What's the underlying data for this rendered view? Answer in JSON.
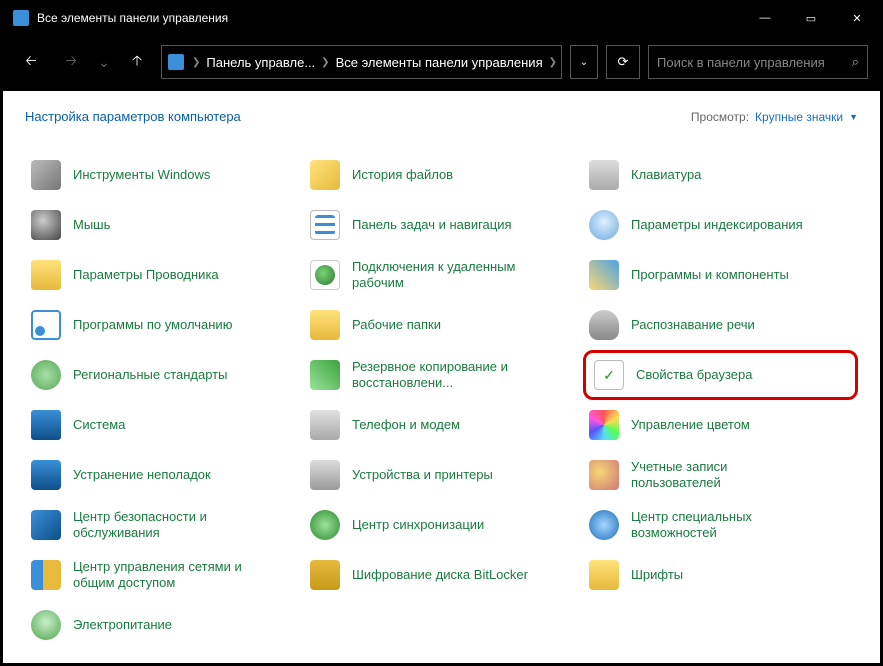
{
  "window": {
    "title": "Все элементы панели управления",
    "minimize": "—",
    "maximize": "▭",
    "close": "✕"
  },
  "nav": {
    "back": "🡠",
    "forward": "🡢",
    "history_chev": "⌄",
    "up": "🡡",
    "refresh": "⟳"
  },
  "breadcrumb": {
    "root": "Панель управле...",
    "current": "Все элементы панели управления",
    "sep": "❯",
    "drop": "⌄"
  },
  "search": {
    "placeholder": "Поиск в панели управления",
    "icon": "⌕"
  },
  "heading": "Настройка параметров компьютера",
  "view": {
    "label": "Просмотр:",
    "value": "Крупные значки",
    "chev": "▼"
  },
  "items": [
    {
      "label": "Инструменты Windows",
      "icon": "i-tool",
      "name": "windows-tools"
    },
    {
      "label": "История файлов",
      "icon": "i-hist",
      "name": "file-history"
    },
    {
      "label": "Клавиатура",
      "icon": "i-kbd",
      "name": "keyboard"
    },
    {
      "label": "Мышь",
      "icon": "i-mouse",
      "name": "mouse"
    },
    {
      "label": "Панель задач и навигация",
      "icon": "i-task",
      "name": "taskbar-nav"
    },
    {
      "label": "Параметры индексирования",
      "icon": "i-index",
      "name": "indexing"
    },
    {
      "label": "Параметры Проводника",
      "icon": "i-folder",
      "name": "explorer-options"
    },
    {
      "label": "Подключения к удаленным рабочим",
      "icon": "i-rdp",
      "name": "remote-desktop"
    },
    {
      "label": "Программы и компоненты",
      "icon": "i-prog",
      "name": "programs-features"
    },
    {
      "label": "Программы по умолчанию",
      "icon": "i-defapp",
      "name": "default-programs"
    },
    {
      "label": "Рабочие папки",
      "icon": "i-workf",
      "name": "work-folders"
    },
    {
      "label": "Распознавание речи",
      "icon": "i-speech",
      "name": "speech"
    },
    {
      "label": "Региональные стандарты",
      "icon": "i-region",
      "name": "region"
    },
    {
      "label": "Резервное копирование и восстановлени...",
      "icon": "i-backup",
      "name": "backup-restore"
    },
    {
      "label": "Свойства браузера",
      "icon": "i-browser",
      "name": "internet-options",
      "highlight": true
    },
    {
      "label": "Система",
      "icon": "i-system",
      "name": "system"
    },
    {
      "label": "Телефон и модем",
      "icon": "i-phone",
      "name": "phone-modem"
    },
    {
      "label": "Управление цветом",
      "icon": "i-color",
      "name": "color-management"
    },
    {
      "label": "Устранение неполадок",
      "icon": "i-trouble",
      "name": "troubleshoot"
    },
    {
      "label": "Устройства и принтеры",
      "icon": "i-printer",
      "name": "devices-printers"
    },
    {
      "label": "Учетные записи пользователей",
      "icon": "i-users",
      "name": "user-accounts"
    },
    {
      "label": "Центр безопасности и обслуживания",
      "icon": "i-security",
      "name": "security-maint"
    },
    {
      "label": "Центр синхронизации",
      "icon": "i-sync",
      "name": "sync-center"
    },
    {
      "label": "Центр специальных возможностей",
      "icon": "i-access",
      "name": "ease-of-access"
    },
    {
      "label": "Центр управления сетями и общим доступом",
      "icon": "i-network",
      "name": "network-sharing"
    },
    {
      "label": "Шифрование диска BitLocker",
      "icon": "i-bitlocker",
      "name": "bitlocker"
    },
    {
      "label": "Шрифты",
      "icon": "i-fonts",
      "name": "fonts"
    },
    {
      "label": "Электропитание",
      "icon": "i-power",
      "name": "power"
    }
  ]
}
